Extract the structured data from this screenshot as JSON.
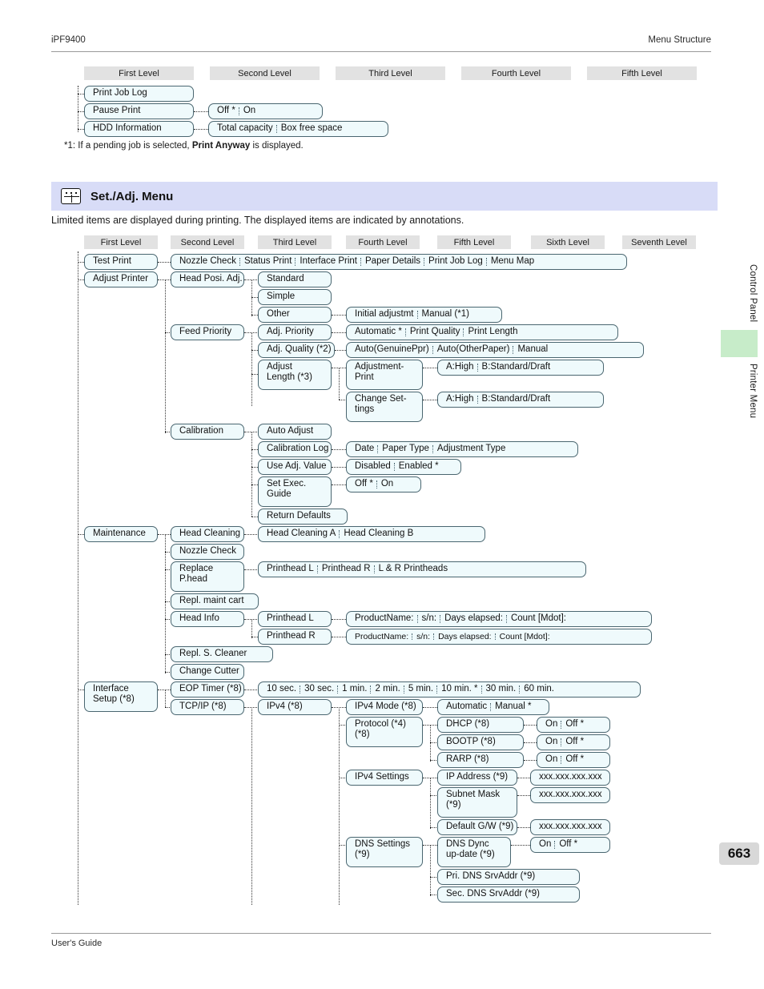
{
  "header": {
    "model": "iPF9400",
    "doc_section": "Menu Structure"
  },
  "footer": {
    "guide_label": "User's Guide",
    "page_number": "663"
  },
  "side_tabs": {
    "tab1": "Control Panel",
    "tab2": "Printer Menu",
    "highlight_color": "#c7ecc9"
  },
  "top_table": {
    "level_headers": [
      "First Level",
      "Second Level",
      "Third Level",
      "Fourth Level",
      "Fifth Level"
    ],
    "rows": [
      {
        "first": "Print Job Log",
        "second": []
      },
      {
        "first": "Pause Print",
        "second": [
          "Off *",
          "On"
        ]
      },
      {
        "first": "HDD Information",
        "second": [
          "Total capacity",
          "Box free space"
        ]
      }
    ],
    "footnote_prefix": "*1: If a pending job is selected, ",
    "footnote_bold": "Print Anyway",
    "footnote_suffix": " is displayed."
  },
  "section": {
    "icon": "sliders-icon",
    "title": "Set./Adj. Menu",
    "intro": "Limited items are displayed during printing. The displayed items are indicated by annotations.",
    "banner_color": "#d8dcf7"
  },
  "main_table": {
    "level_headers": [
      "First Level",
      "Second Level",
      "Third Level",
      "Fourth Level",
      "Fifth Level",
      "Sixth Level",
      "Seventh Level"
    ]
  },
  "menu": {
    "test_print": {
      "label": "Test Print",
      "children": [
        "Nozzle Check",
        "Status Print",
        "Interface Print",
        "Paper Details",
        "Print Job Log",
        "Menu Map"
      ]
    },
    "adjust_printer": {
      "label": "Adjust Printer",
      "head_posi_adj": {
        "label": "Head Posi. Adj.",
        "standard": "Standard",
        "simple": "Simple",
        "other": "Other",
        "other_children": [
          "Initial adjustmt",
          "Manual (*1)"
        ]
      },
      "feed_priority": {
        "label": "Feed Priority",
        "adj_priority": "Adj. Priority",
        "adj_priority_children": [
          "Automatic *",
          "Print Quality",
          "Print Length"
        ],
        "adj_quality": "Adj. Quality (*2)",
        "adj_quality_children": [
          "Auto(GenuinePpr)",
          "Auto(OtherPaper)",
          "Manual"
        ],
        "adjust_length": "Adjust Length (*3)",
        "adjustment_print": "Adjustment-Print",
        "adjustment_print_children": [
          "A:High",
          "B:Standard/Draft"
        ],
        "change_settings": "Change Set-tings",
        "change_settings_children": [
          "A:High",
          "B:Standard/Draft"
        ]
      },
      "calibration": {
        "label": "Calibration",
        "auto_adjust": "Auto Adjust",
        "calibration_log": "Calibration Log",
        "calibration_log_children": [
          "Date",
          "Paper Type",
          "Adjustment Type"
        ],
        "use_adj_value": "Use Adj. Value",
        "use_adj_value_children": [
          "Disabled",
          "Enabled *"
        ],
        "set_exec_guide": "Set Exec. Guide",
        "set_exec_guide_children": [
          "Off *",
          "On"
        ],
        "return_defaults": "Return Defaults"
      }
    },
    "maintenance": {
      "label": "Maintenance",
      "head_cleaning": "Head Cleaning",
      "head_cleaning_children": [
        "Head Cleaning A",
        "Head Cleaning B"
      ],
      "nozzle_check": "Nozzle Check",
      "replace_phead": "Replace P.head",
      "replace_phead_children": [
        "Printhead L",
        "Printhead R",
        "L & R Printheads"
      ],
      "repl_maint_cart": "Repl. maint cart",
      "head_info": "Head Info",
      "printhead_l": "Printhead L",
      "printhead_l_children": [
        "ProductName:",
        "s/n:",
        "Days elapsed:",
        "Count [Mdot]:"
      ],
      "printhead_r": "Printhead R",
      "printhead_r_children": [
        "ProductName:",
        "s/n:",
        "Days elapsed:",
        "Count [Mdot]:"
      ],
      "repl_s_cleaner": "Repl. S. Cleaner",
      "change_cutter": "Change Cutter"
    },
    "interface_setup": {
      "label": "Interface Setup (*8)",
      "eop_timer": "EOP Timer (*8)",
      "eop_timer_children": [
        "10 sec.",
        "30 sec.",
        "1 min.",
        "2 min.",
        "5 min.",
        "10 min. *",
        "30 min.",
        "60 min."
      ],
      "tcpip": "TCP/IP (*8)",
      "ipv4": "IPv4 (*8)",
      "ipv4_mode": "IPv4 Mode (*8)",
      "ipv4_mode_children": [
        "Automatic",
        "Manual *"
      ],
      "protocol": "Protocol (*4) (*8)",
      "dhcp": "DHCP (*8)",
      "dhcp_children": [
        "On",
        "Off *"
      ],
      "bootp": "BOOTP (*8)",
      "bootp_children": [
        "On",
        "Off *"
      ],
      "rarp": "RARP (*8)",
      "rarp_children": [
        "On",
        "Off *"
      ],
      "ipv4_settings": "IPv4 Settings",
      "ip_address": "IP Address (*9)",
      "ip_address_value": "xxx.xxx.xxx.xxx",
      "subnet_mask": "Subnet Mask (*9)",
      "subnet_mask_value": "xxx.xxx.xxx.xxx",
      "default_gw": "Default G/W (*9)",
      "default_gw_value": "xxx.xxx.xxx.xxx",
      "dns_settings": "DNS Settings (*9)",
      "dns_dync_update": "DNS Dync up-date (*9)",
      "dns_dync_update_children": [
        "On",
        "Off *"
      ],
      "pri_dns": "Pri. DNS SrvAddr (*9)",
      "sec_dns": "Sec. DNS SrvAddr (*9)"
    }
  }
}
